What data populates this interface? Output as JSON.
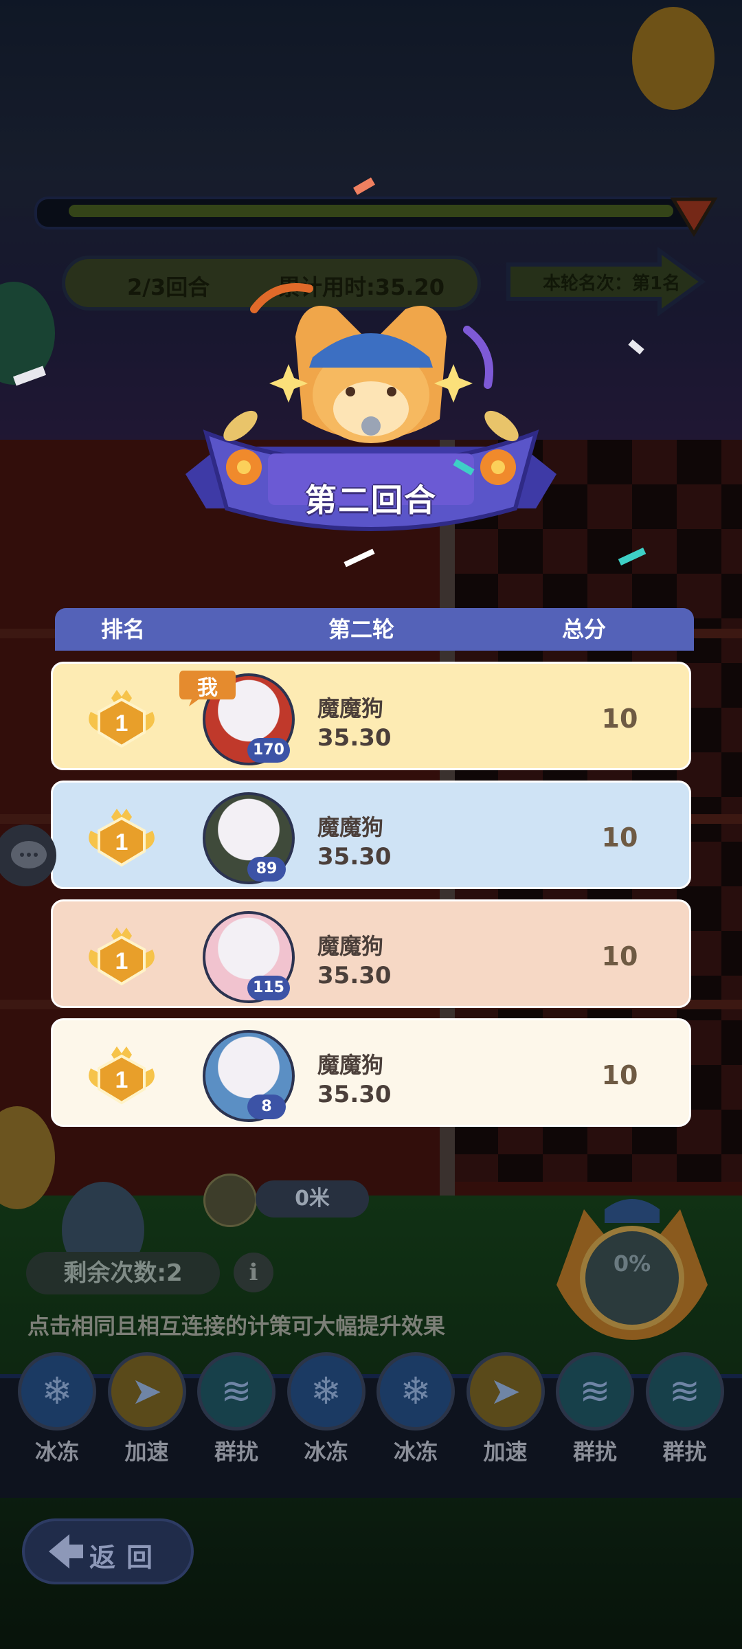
{
  "hud": {
    "round": "2/3回合",
    "total_time": "累计用时:35.20",
    "round_rank": "本轮名次：第1名"
  },
  "banner": {
    "title": "第二回合"
  },
  "table": {
    "headers": [
      "排名",
      "第二轮",
      "总分"
    ],
    "rows": [
      {
        "rank": "1",
        "name": "魔魔狗",
        "time": "35.30",
        "score": "10",
        "level": "170",
        "me_tag": "我",
        "bg": "#fdebb3"
      },
      {
        "rank": "1",
        "name": "魔魔狗",
        "time": "35.30",
        "score": "10",
        "level": "89",
        "bg": "#cfe3f5"
      },
      {
        "rank": "1",
        "name": "魔魔狗",
        "time": "35.30",
        "score": "10",
        "level": "115",
        "bg": "#f6d8c5"
      },
      {
        "rank": "1",
        "name": "魔魔狗",
        "time": "35.30",
        "score": "10",
        "level": "8",
        "bg": "#fdf7ea"
      }
    ]
  },
  "race": {
    "distance": "0米"
  },
  "controls": {
    "remaining": "剩余次数:2",
    "info_icon": "i",
    "hint": "点击相同且相互连接的计策可大幅提升效果",
    "charge": "0%",
    "skills": [
      {
        "label": "冰冻",
        "kind": "freeze"
      },
      {
        "label": "加速",
        "kind": "speed"
      },
      {
        "label": "群扰",
        "kind": "disturb"
      },
      {
        "label": "冰冻",
        "kind": "freeze"
      },
      {
        "label": "冰冻",
        "kind": "freeze"
      },
      {
        "label": "加速",
        "kind": "speed"
      },
      {
        "label": "群扰",
        "kind": "disturb"
      },
      {
        "label": "群扰",
        "kind": "disturb"
      }
    ],
    "back": "返回"
  },
  "colors": {
    "header_bar": "#5462b8",
    "level_badge": "#3c53a6",
    "ribbon": "#5a55c9",
    "medal_gold": "#f3b337"
  }
}
